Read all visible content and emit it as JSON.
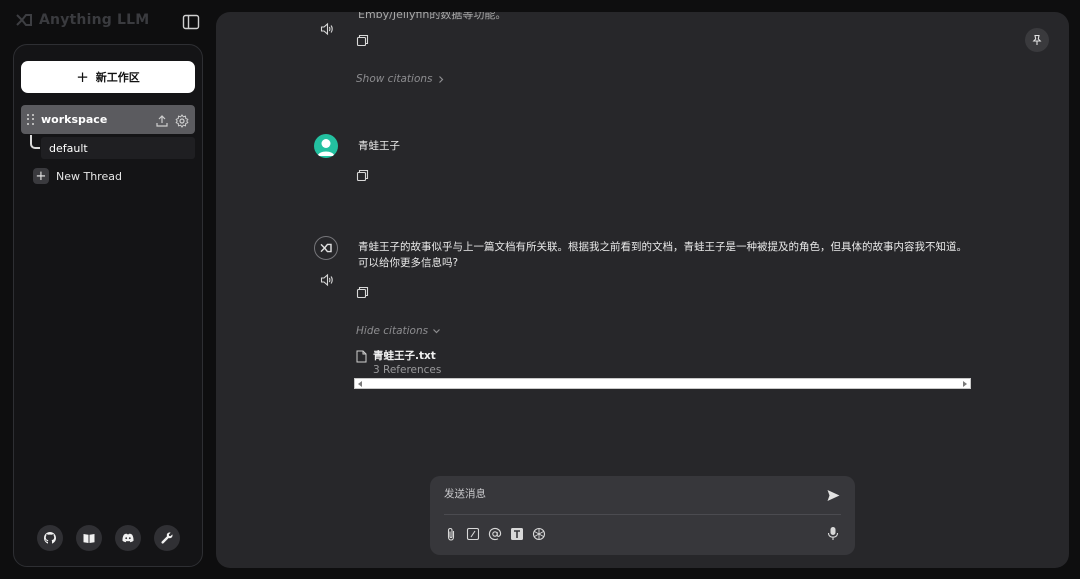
{
  "app": {
    "brand": "Anything LLM"
  },
  "sidebar": {
    "new_workspace_label": "新工作区",
    "workspace": {
      "name": "workspace"
    },
    "threads": [
      {
        "label": "default"
      }
    ],
    "new_thread_label": "New Thread",
    "footer_icons": [
      "github-icon",
      "book-icon",
      "discord-icon",
      "wrench-icon"
    ]
  },
  "chat": {
    "partial_top_text": "Emby/Jellyfin的数据等功能。",
    "show_citations_label": "Show citations",
    "user_message": "青蛙王子",
    "assistant_message_line1": "青蛙王子的故事似乎与上一篇文档有所关联。根据我之前看到的文档，青蛙王子是一种被提及的角色，但具体的故事内容我不知道。",
    "assistant_message_line2": "可以给你更多信息吗?",
    "hide_citations_label": "Hide citations",
    "citation": {
      "file": "青蛙王子.txt",
      "references": "3 References"
    }
  },
  "composer": {
    "placeholder": "发送消息",
    "tools": [
      "paperclip-icon",
      "slash-command-icon",
      "at-mention-icon",
      "text-size-icon",
      "agent-icon"
    ]
  },
  "colors": {
    "accent_avatar": "#23c0a0",
    "panel": "#27272a",
    "background": "#0e0e0f"
  }
}
